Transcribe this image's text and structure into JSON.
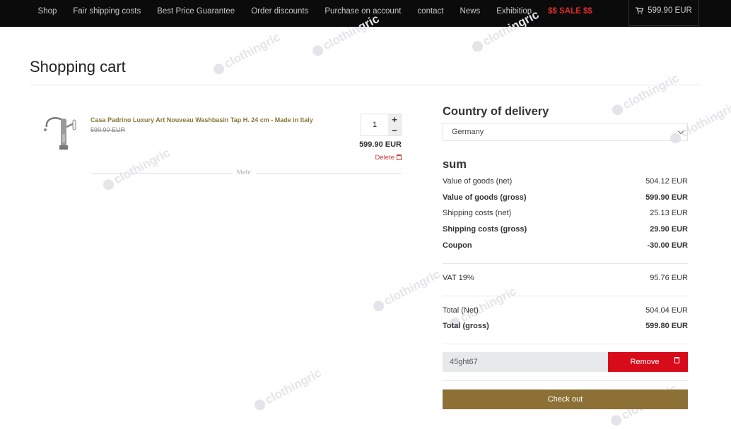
{
  "nav": {
    "items": [
      "Shop",
      "Fair shipping costs",
      "Best Price Guarantee",
      "Order discounts",
      "Purchase on account",
      "contact",
      "News",
      "Exhibition"
    ],
    "sale": "$$ SALE $$",
    "cart_total": "599.90 EUR"
  },
  "watermark": "clothingric",
  "page": {
    "title": "Shopping cart"
  },
  "cart": {
    "item": {
      "name": "Casa Padrino Luxury Art Nouveau Washbasin Tap H. 24 cm - Made in Italy",
      "old_price": "599.90 EUR",
      "quantity": "1",
      "plus": "+",
      "minus": "−",
      "price": "599.90 EUR",
      "delete": "Delete"
    },
    "more": "Mehr"
  },
  "delivery": {
    "title": "Country of delivery",
    "country": "Germany"
  },
  "sum": {
    "title": "sum",
    "goods_net_label": "Value of goods (net)",
    "goods_net": "504.12 EUR",
    "goods_gross_label": "Value of goods (gross)",
    "goods_gross": "599.90 EUR",
    "ship_net_label": "Shipping costs (net)",
    "ship_net": "25.13 EUR",
    "ship_gross_label": "Shipping costs (gross)",
    "ship_gross": "29.90 EUR",
    "coupon_label": "Coupon",
    "coupon": "-30.00 EUR",
    "vat_label": "VAT 19%",
    "vat": "95.76 EUR",
    "total_net_label": "Total (Net)",
    "total_net": "504.04 EUR",
    "total_gross_label": "Total (gross)",
    "total_gross": "599.80 EUR"
  },
  "coupon": {
    "code": "45ght67",
    "remove": "Remove"
  },
  "checkout": "Check out",
  "colors": {
    "accent": "#8c7036",
    "danger": "#d80b1b",
    "topbar": "#0b0b0b"
  }
}
